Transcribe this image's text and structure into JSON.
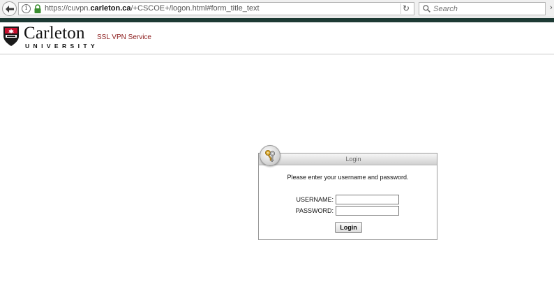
{
  "browser": {
    "url_prefix": "https://cuvpn.",
    "url_domain": "carleton.ca",
    "url_path": "/+CSCOE+/logon.html#form_title_text",
    "search_placeholder": "Search",
    "info_glyph": "i"
  },
  "header": {
    "logo_word": "Carleton",
    "logo_sub": "UNIVERSITY",
    "service_title": "SSL VPN Service"
  },
  "login": {
    "title": "Login",
    "prompt": "Please enter your username and password.",
    "username_label": "USERNAME:",
    "password_label": "PASSWORD:",
    "username_value": "",
    "password_value": "",
    "button_label": "Login"
  },
  "colors": {
    "brand_red": "#8b1a1a",
    "top_band": "#1d3a34"
  }
}
